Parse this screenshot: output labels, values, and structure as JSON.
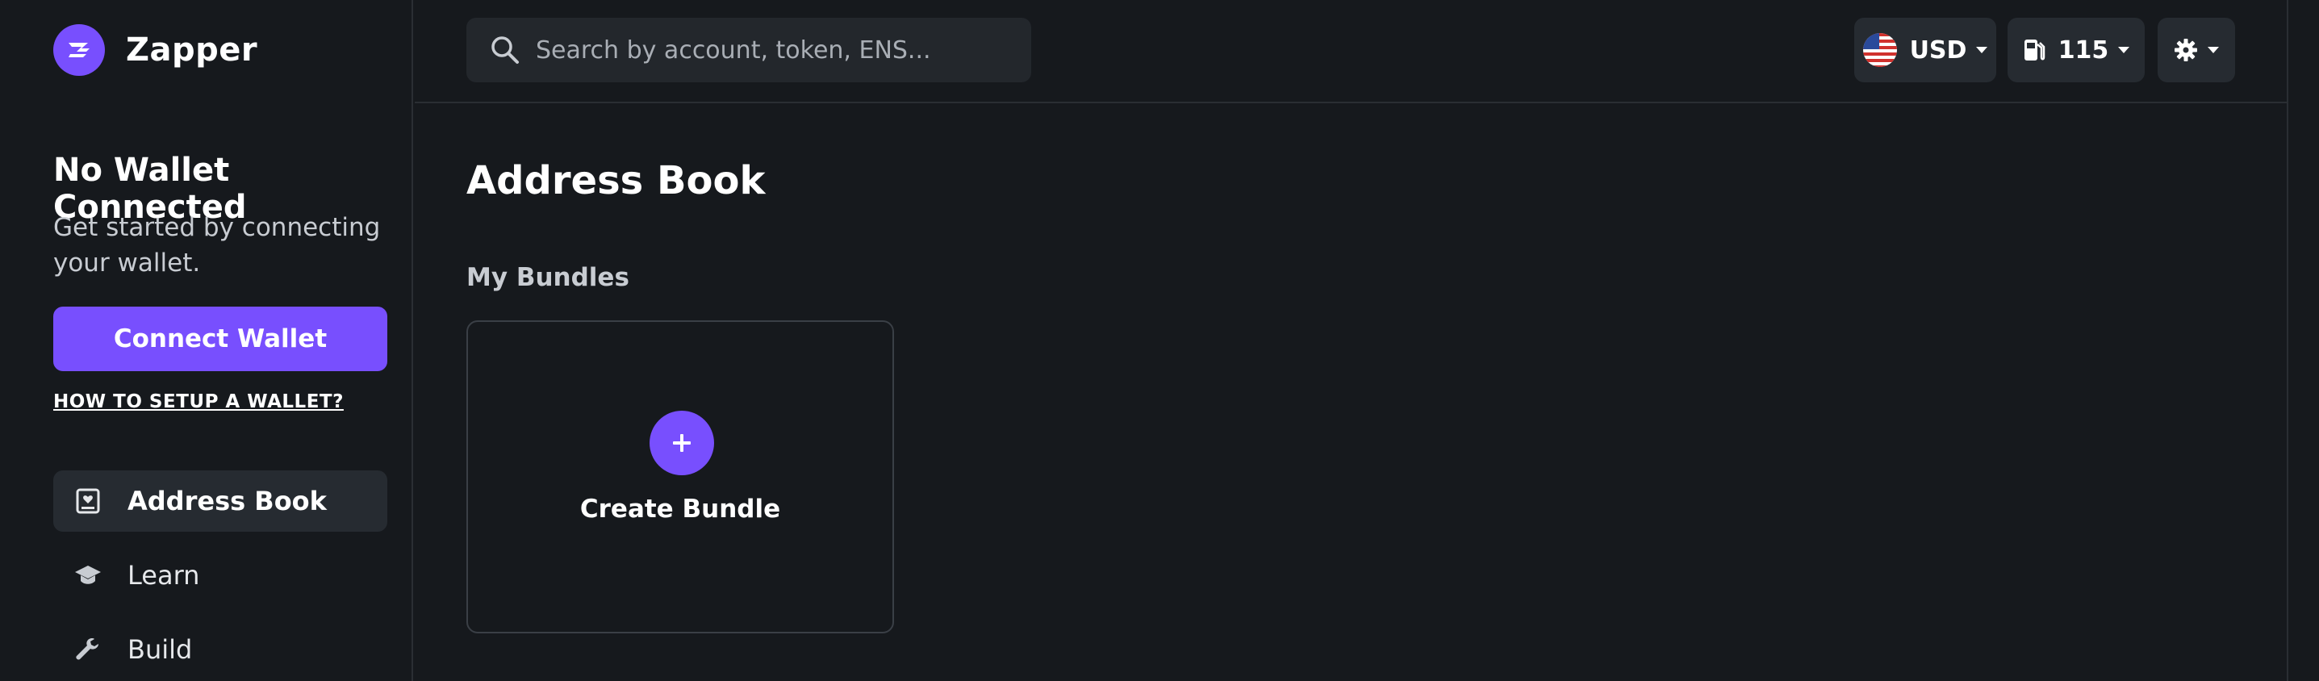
{
  "brand": {
    "name": "Zapper"
  },
  "wallet": {
    "title": "No Wallet Connected",
    "description": "Get started by connecting your wallet.",
    "connect_label": "Connect Wallet",
    "howto_link": "HOW TO SETUP A WALLET?"
  },
  "nav": {
    "items": [
      {
        "label": "Address Book",
        "icon": "address-book-icon",
        "active": true
      },
      {
        "label": "Learn",
        "icon": "graduation-cap-icon",
        "active": false
      },
      {
        "label": "Build",
        "icon": "wrench-icon",
        "active": false
      }
    ]
  },
  "header": {
    "search_placeholder": "Search by account, token, ENS...",
    "currency": "USD",
    "currency_icon": "us-flag-icon",
    "gas": "115",
    "gas_icon": "gas-pump-icon",
    "settings_icon": "gear-icon"
  },
  "main": {
    "page_title": "Address Book",
    "section_title": "My Bundles",
    "create_bundle_label": "Create Bundle"
  },
  "colors": {
    "background": "#16191d",
    "accent": "#784ffe",
    "surface": "#262b31",
    "border": "#2a2e33"
  }
}
